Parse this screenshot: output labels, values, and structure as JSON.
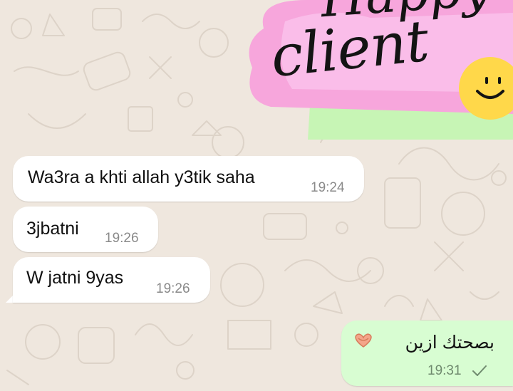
{
  "sticker": {
    "top_word": "Happy",
    "bottom_word": "client",
    "colors": {
      "pink": "#f7a6dc",
      "pink_light": "#fbc8ee",
      "green": "#c7f5b5",
      "yellow": "#ffd84a"
    }
  },
  "messages": [
    {
      "direction": "incoming",
      "text": "Wa3ra a khti allah y3tik saha",
      "time": "19:24"
    },
    {
      "direction": "incoming",
      "text": "3jbatni",
      "time": "19:26"
    },
    {
      "direction": "incoming",
      "text": "W jatni 9yas",
      "time": "19:26"
    },
    {
      "direction": "outgoing",
      "text": "بصحتك ازين",
      "emoji": "heart-hands-icon",
      "time": "19:31",
      "status": "sent-check-icon"
    }
  ],
  "theme": {
    "wallpaper": "#efe7de",
    "incoming_bubble": "#ffffff",
    "outgoing_bubble": "#d8fdd2"
  }
}
